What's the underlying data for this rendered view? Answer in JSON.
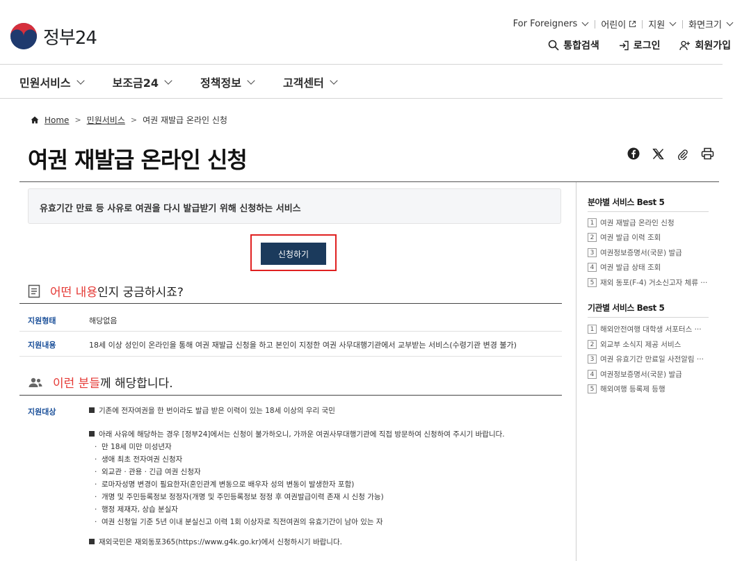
{
  "header": {
    "logo_text": "정부24",
    "util": [
      "For Foreigners",
      "어린이",
      "지원",
      "화면크기"
    ],
    "actions": [
      "통합검색",
      "로그인",
      "회원가입"
    ]
  },
  "gnb": [
    "민원서비스",
    "보조금24",
    "정책정보",
    "고객센터"
  ],
  "breadcrumb": [
    "Home",
    "민원서비스",
    "여권 재발급 온라인 신청"
  ],
  "page": {
    "title": "여권 재발급 온라인 신청",
    "summary": "유효기간 만료 등 사유로 여권을 다시 발급받기 위해 신청하는 서비스",
    "apply_label": "신청하기"
  },
  "section1": {
    "title_red": "어떤 내용",
    "title_rest": "인지 궁금하시죠?",
    "rows": [
      {
        "label": "지원형태",
        "value": "해당없음"
      },
      {
        "label": "지원내용",
        "value": "18세 이상 성인이 온라인을 통해 여권 재발급 신청을 하고 본인이 지정한 여권 사무대행기관에서 교부받는 서비스(수령기관 변경 불가)"
      }
    ]
  },
  "section2": {
    "title_red": "이런 분들",
    "title_rest": "께 해당합니다.",
    "label": "지원대상",
    "para1": "기존에 전자여권을 한 번이라도 발급 받은 이력이 있는 18세 이상의 우리 국민",
    "para2": "아래 사유에 해당하는 경우 [정부24]에서는 신청이 불가하오니, 가까운 여권사무대행기관에 직접 방문하여 신청하여 주시기 바랍니다.",
    "bullets": [
      "만 18세 미만 미성년자",
      "생애 최초 전자여권 신청자",
      "외교관 · 관용 · 긴급 여권 신청자",
      "로마자성명 변경이 필요한자(혼인관계 변동으로 배우자 성의 변동이 발생한자 포함)",
      "개명 및 주민등록정보 정정자(개명 및 주민등록정보 정정 후 여권발급이력 존재 시 신청 가능)",
      "행정 제재자, 상습 분실자",
      "여권 신청일 기준 5년 이내 분실신고 이력 1회 이상자로 직전여권의 유효기간이 남아 있는 자"
    ],
    "para3": "재외국민은 재외동포365(https://www.g4k.go.kr)에서 신청하시기 바랍니다."
  },
  "sidebar": {
    "best_field": {
      "title": "분야별 서비스 Best 5",
      "items": [
        "여권 재발급 온라인 신청",
        "여권 발급 이력 조회",
        "여권정보증명서(국문) 발급",
        "여권 발급 상태 조회",
        "재외 동포(F-4) 거소신고자 체류 ···"
      ]
    },
    "best_org": {
      "title": "기관별 서비스 Best 5",
      "items": [
        "해외안전여행 대학생 서포터스 ···",
        "외교부 소식지 제공 서비스",
        "여권 유효기간 만료일 사전알림 ···",
        "여권정보증명서(국문) 발급",
        "해외여행 등록제 등행"
      ]
    }
  },
  "colors": {
    "brand_navy": "#1b3a5c",
    "accent_red": "#e53935",
    "label_blue": "#1a4f99"
  }
}
